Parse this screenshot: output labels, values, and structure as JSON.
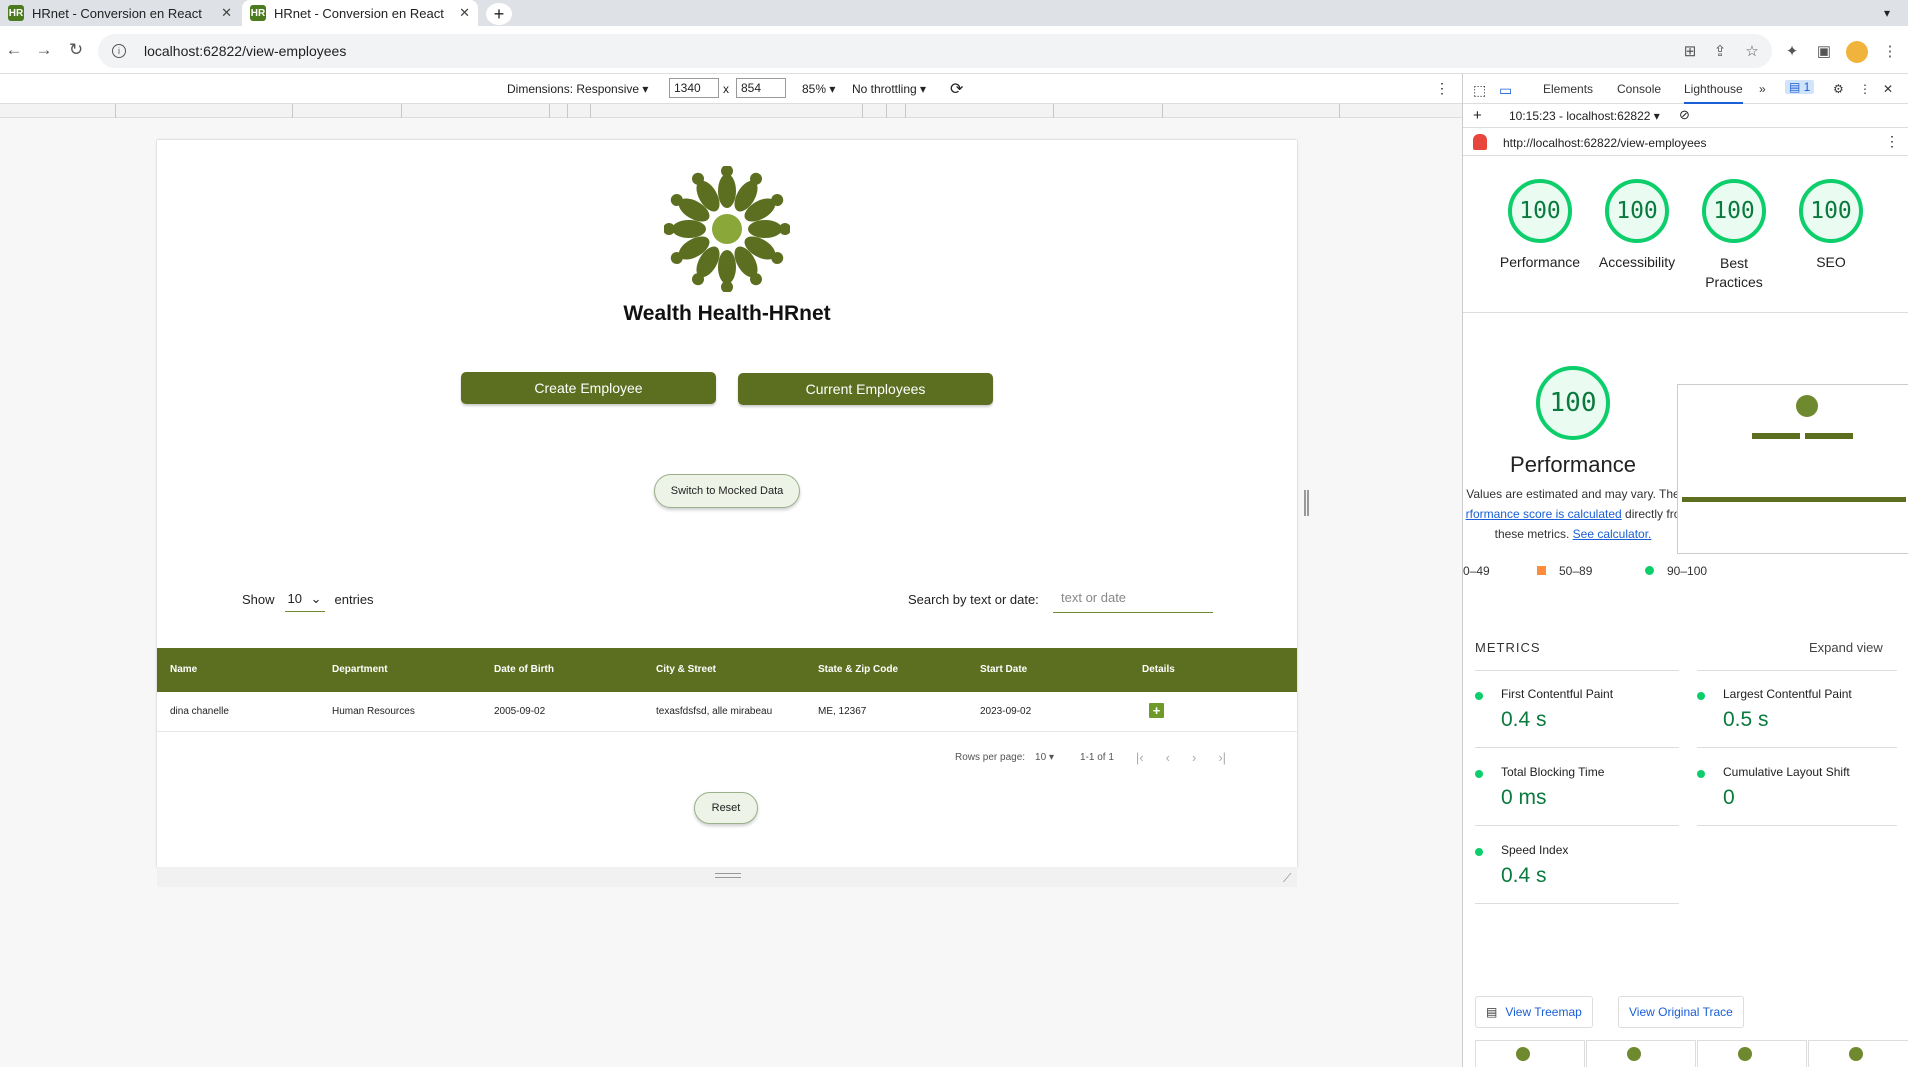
{
  "browser": {
    "tabs": [
      {
        "title": "HRnet - Conversion en React",
        "favicon": "HR"
      },
      {
        "title": "HRnet - Conversion en React",
        "favicon": "HR"
      }
    ],
    "url": "localhost:62822/view-employees"
  },
  "device_toolbar": {
    "dimensions_label": "Dimensions: Responsive",
    "width": "1340",
    "height": "854",
    "zoom": "85%",
    "throttling": "No throttling"
  },
  "app": {
    "title": "Wealth Health-HRnet",
    "create_button": "Create Employee",
    "current_button": "Current Employees",
    "mock_button": "Switch to Mocked Data",
    "show_label": "Show",
    "show_value": "10",
    "entries_label": "entries",
    "search_label": "Search by text or date:",
    "search_placeholder": "text or date",
    "table": {
      "headers": [
        "Name",
        "Department",
        "Date of Birth",
        "City & Street",
        "State & Zip Code",
        "Start Date",
        "Details"
      ],
      "rows": [
        [
          "dina chanelle",
          "Human Resources",
          "2005-09-02",
          "texasfdsfsd, alle mirabeau",
          "ME, 12367",
          "2023-09-02"
        ]
      ]
    },
    "pagination": {
      "rows_label": "Rows per page:",
      "rows_value": "10",
      "range": "1-1 of 1"
    },
    "reset_button": "Reset"
  },
  "devtools": {
    "tabs": [
      "Elements",
      "Console",
      "Lighthouse"
    ],
    "issues_count": "1",
    "report_select": "10:15:23 - localhost:62822",
    "report_url": "http://localhost:62822/view-employees",
    "scores": [
      {
        "label": "Performance",
        "value": "100"
      },
      {
        "label": "Accessibility",
        "value": "100"
      },
      {
        "label": "Best",
        "label2": "Practices",
        "value": "100"
      },
      {
        "label": "SEO",
        "value": "100"
      }
    ],
    "perf_score": "100",
    "perf_title": "Performance",
    "perf_note_1": "Values are estimated and may vary. The",
    "perf_note_link": "rformance score is calculated",
    "perf_note_2": "directly fro",
    "perf_note_3": "these metrics.",
    "perf_note_calc": "See calculator.",
    "legend": [
      "0–49",
      "50–89",
      "90–100"
    ],
    "metrics_title": "METRICS",
    "expand_label": "Expand view",
    "metrics": [
      {
        "name": "First Contentful Paint",
        "value": "0.4 s"
      },
      {
        "name": "Largest Contentful Paint",
        "value": "0.5 s"
      },
      {
        "name": "Total Blocking Time",
        "value": "0 ms"
      },
      {
        "name": "Cumulative Layout Shift",
        "value": "0"
      },
      {
        "name": "Speed Index",
        "value": "0.4 s"
      }
    ],
    "treemap_button": "View Treemap",
    "trace_button": "View Original Trace"
  },
  "colors": {
    "brand_green": "#5c6e1f",
    "score_green": "#0cce6b",
    "link_blue": "#1a5fd6"
  }
}
